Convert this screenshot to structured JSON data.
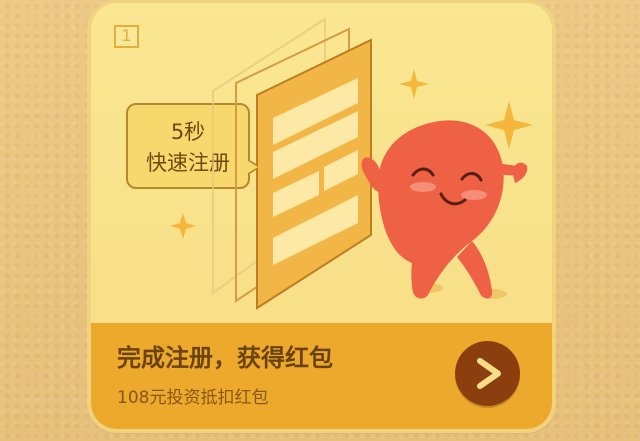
{
  "card": {
    "step_number": "1",
    "bubble_lines": [
      "5秒",
      "快速注册"
    ],
    "title": "完成注册，获得红包",
    "subtitle": "108元投资抵扣红包"
  },
  "icons": {
    "badge": "number-badge-icon",
    "next": "chevron-right-icon",
    "sparkles": "sparkle-icon",
    "mascot": "mascot-icon"
  },
  "colors": {
    "page_bg": "#e8c57c",
    "card_top": "#f9e48c",
    "card_bottom": "#eca92b",
    "text_dark": "#6b4312",
    "button": "#8b3f0f"
  }
}
